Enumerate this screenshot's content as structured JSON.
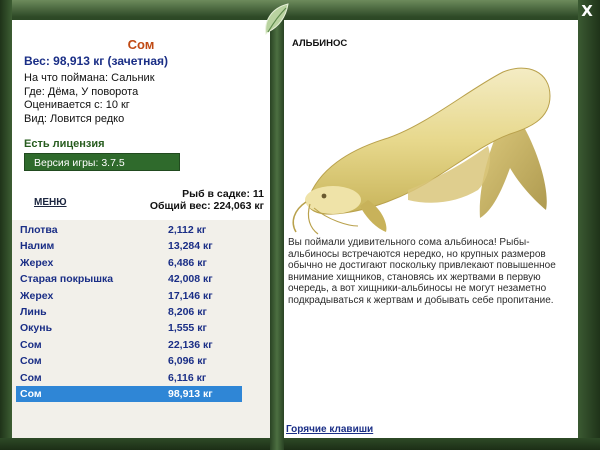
{
  "header": {
    "close_label": "X"
  },
  "fish": {
    "name": "Сом",
    "weight_line": "Вес: 98,913 кг (зачетная)",
    "bait_line": "На что поймана: Сальник",
    "place_line": "Где: Дёма, У поворота",
    "value_line": "Оценивается с: 10 кг",
    "kind_line": "Вид: Ловится редко"
  },
  "license": "Есть лицензия",
  "version": "Версия игры: 3.7.5",
  "menu_label": "МЕНЮ",
  "keepnet": {
    "count_line": "Рыб в садке: 11",
    "total_line": "Общий вес: 224,063 кг"
  },
  "catch_list": [
    {
      "name": "Плотва",
      "weight": "2,112 кг"
    },
    {
      "name": "Налим",
      "weight": "13,284 кг"
    },
    {
      "name": "Жерех",
      "weight": "6,486 кг"
    },
    {
      "name": "Старая покрышка",
      "weight": "42,008 кг"
    },
    {
      "name": "Жерех",
      "weight": "17,146 кг"
    },
    {
      "name": "Линь",
      "weight": "8,206 кг"
    },
    {
      "name": "Окунь",
      "weight": "1,555 кг"
    },
    {
      "name": "Сом",
      "weight": "22,136 кг"
    },
    {
      "name": "Сом",
      "weight": "6,096 кг"
    },
    {
      "name": "Сом",
      "weight": "6,116 кг"
    },
    {
      "name": "Сом",
      "weight": "98,913 кг"
    }
  ],
  "selected_index": 10,
  "detail": {
    "tag": "АЛЬБИНОС",
    "description": "Вы поймали удивительного сома альбиноса! Рыбы-альбиносы встречаются нередко, но крупных размеров обычно не достигают поскольку привлекают повышенное внимание хищников, становясь их жертвами в первую очередь, а вот хищники-альбиносы не могут незаметно подкрадываться к жертвам и добывать себе пропитание.",
    "hotkeys_label": "Горячие клавиши"
  },
  "colors": {
    "accent": "#c04a14",
    "link_blue": "#1a2e86",
    "selection": "#2f86d6",
    "frame_green": "#2f4a2a"
  }
}
